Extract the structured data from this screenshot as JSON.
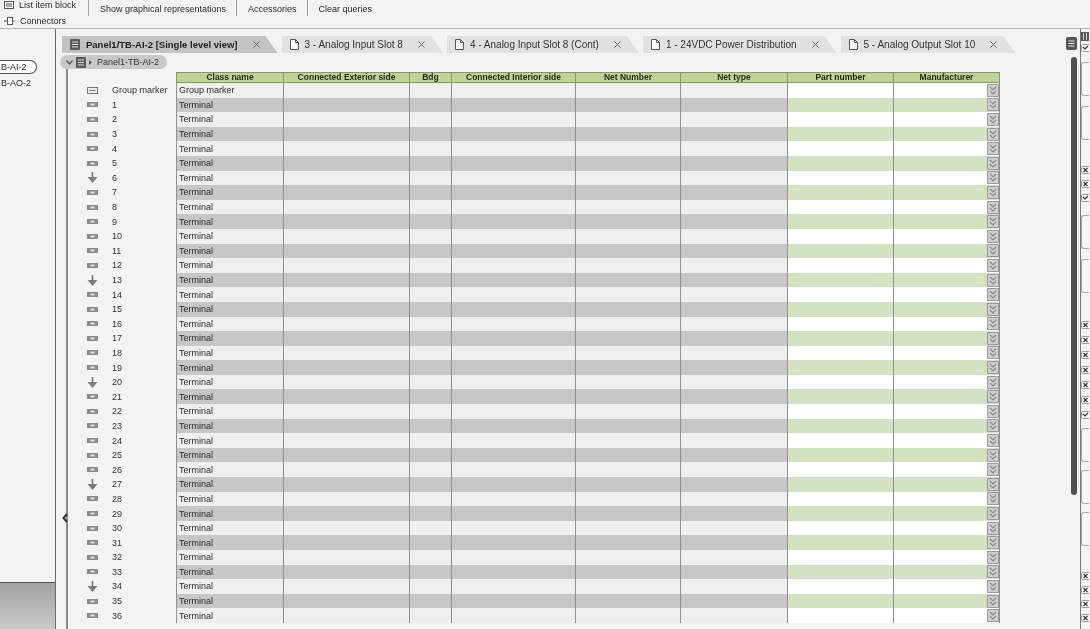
{
  "toolbar": {
    "items": [
      {
        "label": "List item block",
        "kind": "list"
      },
      {
        "label": "Connectors",
        "kind": "connector"
      }
    ],
    "buttons": [
      "Show graphical representations",
      "Accessories",
      "Clear queries"
    ]
  },
  "left_panel": {
    "items": [
      {
        "label": "B-AI-2",
        "selected": true
      },
      {
        "label": "B-AO-2",
        "selected": false
      }
    ]
  },
  "tabs": [
    {
      "label": "Panel1/TB-AI-2 [Single level view]",
      "kind": "view",
      "selected": true
    },
    {
      "label": "3 - Analog Input Slot 8",
      "kind": "page",
      "selected": false
    },
    {
      "label": "4 - Analog Input Slot 8 (Cont)",
      "kind": "page",
      "selected": false
    },
    {
      "label": "1 - 24VDC Power Distribution",
      "kind": "page",
      "selected": false
    },
    {
      "label": "5 - Analog Output Slot 10",
      "kind": "page",
      "selected": false
    }
  ],
  "breadcrumb": {
    "label": "Panel1-TB-AI-2"
  },
  "table": {
    "columns": [
      {
        "label": "Class name",
        "kind": "text"
      },
      {
        "label": "Connected Exterior side",
        "kind": "text"
      },
      {
        "label": "Bdg",
        "kind": "text"
      },
      {
        "label": "Connected Interior side",
        "kind": "text"
      },
      {
        "label": "Net Number",
        "kind": "text"
      },
      {
        "label": "Net type",
        "kind": "text"
      },
      {
        "label": "Part number",
        "kind": "input"
      },
      {
        "label": "Manufacturer",
        "kind": "select"
      }
    ],
    "rows": [
      {
        "kind": "group_marker",
        "label": "Group marker",
        "class_name": "Group marker"
      },
      {
        "kind": "terminal",
        "label": "1",
        "class_name": "Terminal"
      },
      {
        "kind": "terminal",
        "label": "2",
        "class_name": "Terminal"
      },
      {
        "kind": "terminal",
        "label": "3",
        "class_name": "Terminal"
      },
      {
        "kind": "terminal",
        "label": "4",
        "class_name": "Terminal"
      },
      {
        "kind": "terminal",
        "label": "5",
        "class_name": "Terminal"
      },
      {
        "kind": "ground",
        "label": "6",
        "class_name": "Terminal"
      },
      {
        "kind": "terminal",
        "label": "7",
        "class_name": "Terminal"
      },
      {
        "kind": "terminal",
        "label": "8",
        "class_name": "Terminal"
      },
      {
        "kind": "terminal",
        "label": "9",
        "class_name": "Terminal"
      },
      {
        "kind": "terminal",
        "label": "10",
        "class_name": "Terminal"
      },
      {
        "kind": "terminal",
        "label": "11",
        "class_name": "Terminal"
      },
      {
        "kind": "terminal",
        "label": "12",
        "class_name": "Terminal"
      },
      {
        "kind": "ground",
        "label": "13",
        "class_name": "Terminal"
      },
      {
        "kind": "terminal",
        "label": "14",
        "class_name": "Terminal"
      },
      {
        "kind": "terminal",
        "label": "15",
        "class_name": "Terminal"
      },
      {
        "kind": "terminal",
        "label": "16",
        "class_name": "Terminal"
      },
      {
        "kind": "terminal",
        "label": "17",
        "class_name": "Terminal"
      },
      {
        "kind": "terminal",
        "label": "18",
        "class_name": "Terminal"
      },
      {
        "kind": "terminal",
        "label": "19",
        "class_name": "Terminal"
      },
      {
        "kind": "ground",
        "label": "20",
        "class_name": "Terminal"
      },
      {
        "kind": "terminal",
        "label": "21",
        "class_name": "Terminal"
      },
      {
        "kind": "terminal",
        "label": "22",
        "class_name": "Terminal"
      },
      {
        "kind": "terminal",
        "label": "23",
        "class_name": "Terminal"
      },
      {
        "kind": "terminal",
        "label": "24",
        "class_name": "Terminal"
      },
      {
        "kind": "terminal",
        "label": "25",
        "class_name": "Terminal"
      },
      {
        "kind": "terminal",
        "label": "26",
        "class_name": "Terminal"
      },
      {
        "kind": "ground",
        "label": "27",
        "class_name": "Terminal"
      },
      {
        "kind": "terminal",
        "label": "28",
        "class_name": "Terminal"
      },
      {
        "kind": "terminal",
        "label": "29",
        "class_name": "Terminal"
      },
      {
        "kind": "terminal",
        "label": "30",
        "class_name": "Terminal"
      },
      {
        "kind": "terminal",
        "label": "31",
        "class_name": "Terminal"
      },
      {
        "kind": "terminal",
        "label": "32",
        "class_name": "Terminal"
      },
      {
        "kind": "terminal",
        "label": "33",
        "class_name": "Terminal"
      },
      {
        "kind": "ground",
        "label": "34",
        "class_name": "Terminal"
      },
      {
        "kind": "terminal",
        "label": "35",
        "class_name": "Terminal"
      },
      {
        "kind": "terminal",
        "label": "36",
        "class_name": "Terminal"
      }
    ]
  }
}
